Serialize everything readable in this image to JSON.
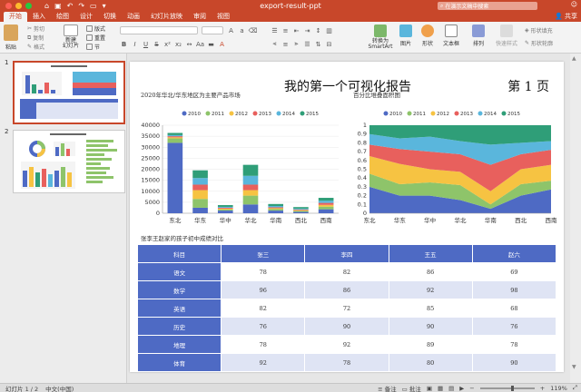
{
  "window": {
    "title": "export-result-ppt",
    "search_placeholder": "在演示文稿中搜索",
    "share_label": "共享"
  },
  "tabs": [
    "开始",
    "插入",
    "绘图",
    "设计",
    "切换",
    "动画",
    "幻灯片放映",
    "审阅",
    "视图"
  ],
  "ribbon": {
    "paste": "粘贴",
    "cut": "剪切",
    "copy": "复制",
    "format": "格式",
    "new_slide": "新建\n幻灯片",
    "layout": "版式",
    "reset": "重置",
    "section": "节",
    "convert_smartart": "转换为\nSmartArt",
    "picture": "图片",
    "shape": "形状",
    "textbox": "文本框",
    "arrange": "排列",
    "quick_styles": "快速样式",
    "shape_fill": "形状填充",
    "shape_outline": "形状轮廓"
  },
  "thumbnails": [
    {
      "number": "1"
    },
    {
      "number": "2"
    }
  ],
  "slide": {
    "title": "我的第一个可视化报告",
    "page_label": "第 1 页",
    "table_title": "张李王赵家的孩子初中成绩对比",
    "table": {
      "headers": [
        "科目",
        "张三",
        "李四",
        "王五",
        "赵六"
      ],
      "rows": [
        [
          "语文",
          "78",
          "82",
          "86",
          "69"
        ],
        [
          "数学",
          "96",
          "86",
          "92",
          "98"
        ],
        [
          "英语",
          "82",
          "72",
          "85",
          "68"
        ],
        [
          "历史",
          "76",
          "90",
          "90",
          "76"
        ],
        [
          "地理",
          "78",
          "92",
          "89",
          "78"
        ],
        [
          "体育",
          "92",
          "78",
          "80",
          "90"
        ]
      ]
    }
  },
  "chart_data": [
    {
      "type": "bar",
      "title": "2020年华北/华东地区为主要产品市场",
      "stacked": true,
      "categories": [
        "东北",
        "华东",
        "华中",
        "华北",
        "华南",
        "西北",
        "西南"
      ],
      "ylim": [
        0,
        40000
      ],
      "yticks": [
        "0",
        "5000",
        "10000",
        "15000",
        "20000",
        "25000",
        "30000",
        "35000",
        "40000"
      ],
      "legend_position": "top",
      "series": [
        {
          "name": "2010",
          "color": "#4e6ac4",
          "values": [
            32000,
            2500,
            1200,
            4000,
            1200,
            600,
            1800
          ]
        },
        {
          "name": "2011",
          "color": "#8ec46a",
          "values": [
            2000,
            4000,
            500,
            4000,
            700,
            500,
            1200
          ]
        },
        {
          "name": "2012",
          "color": "#f6c342",
          "values": [
            500,
            4000,
            400,
            2500,
            400,
            300,
            800
          ]
        },
        {
          "name": "2013",
          "color": "#e8605d",
          "values": [
            500,
            2500,
            400,
            2500,
            400,
            300,
            900
          ]
        },
        {
          "name": "2014",
          "color": "#5ab6dc",
          "values": [
            500,
            3000,
            400,
            4000,
            600,
            400,
            1000
          ]
        },
        {
          "name": "2015",
          "color": "#2f9e78",
          "values": [
            1000,
            3500,
            800,
            5000,
            900,
            700,
            1300
          ]
        }
      ]
    },
    {
      "type": "area",
      "title": "百分比堆叠面积图",
      "stacked": "percent",
      "categories": [
        "东北",
        "华东",
        "华中",
        "华北",
        "华南",
        "西北",
        "西南"
      ],
      "ylim": [
        0,
        1
      ],
      "yticks": [
        "0",
        "0.1",
        "0.2",
        "0.3",
        "0.4",
        "0.5",
        "0.6",
        "0.7",
        "0.8",
        "0.9",
        "1"
      ],
      "legend_position": "top",
      "series": [
        {
          "name": "2010",
          "color": "#4e6ac4",
          "values": [
            0.3,
            0.2,
            0.2,
            0.15,
            0.05,
            0.2,
            0.27
          ]
        },
        {
          "name": "2011",
          "color": "#8ec46a",
          "values": [
            0.15,
            0.13,
            0.15,
            0.17,
            0.05,
            0.13,
            0.1
          ]
        },
        {
          "name": "2012",
          "color": "#f6c342",
          "values": [
            0.2,
            0.23,
            0.15,
            0.15,
            0.15,
            0.17,
            0.18
          ]
        },
        {
          "name": "2013",
          "color": "#e8605d",
          "values": [
            0.13,
            0.17,
            0.2,
            0.2,
            0.3,
            0.17,
            0.17
          ]
        },
        {
          "name": "2014",
          "color": "#5ab6dc",
          "values": [
            0.12,
            0.12,
            0.17,
            0.15,
            0.23,
            0.13,
            0.1
          ]
        },
        {
          "name": "2015",
          "color": "#2f9e78",
          "values": [
            0.1,
            0.15,
            0.13,
            0.18,
            0.22,
            0.2,
            0.18
          ]
        }
      ]
    }
  ],
  "status_bar": {
    "slide_info": "幻灯片 1 / 2",
    "language": "中文(中国)",
    "notes": "备注",
    "comments": "批注",
    "zoom": "119%"
  },
  "colors": {
    "accent": "#c8472a",
    "table_header": "#4e6ac4",
    "table_row_alt": "#dfe4f4"
  }
}
